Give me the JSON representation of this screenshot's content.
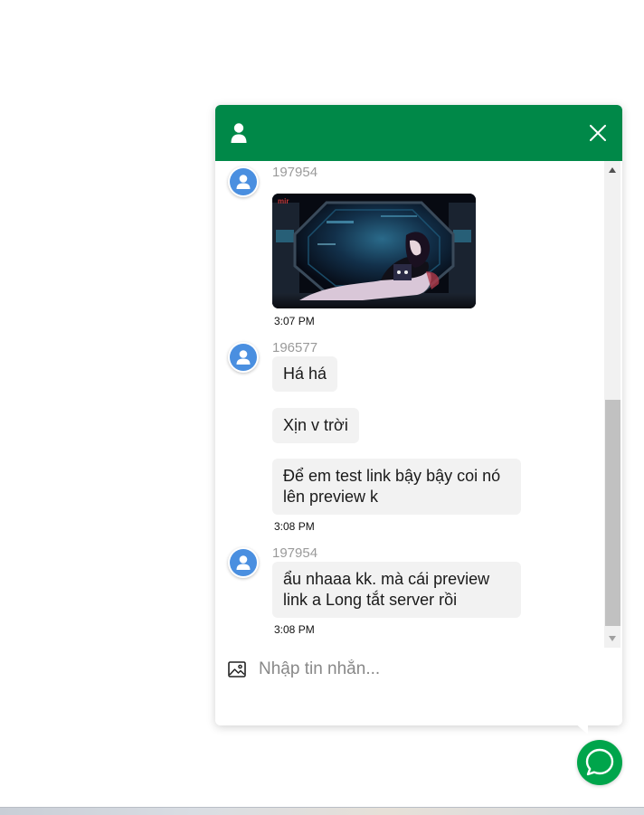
{
  "chat": {
    "header": {
      "user_icon": "user-icon",
      "close_icon": "close-icon"
    },
    "messages": [
      {
        "sender": "197954",
        "image_alt": "Anime girl lying in front of a sci-fi window",
        "time": "3:07 PM"
      },
      {
        "sender": "196577",
        "bubbles": [
          "Há há",
          "Xịn v trời",
          "Để em test link bậy bậy coi nó lên preview k"
        ],
        "time": "3:08 PM"
      },
      {
        "sender": "197954",
        "bubbles": [
          "ẩu nhaaa kk. mà cái preview link a Long tắt server rồi"
        ],
        "time": "3:08 PM"
      }
    ],
    "composer": {
      "placeholder": "Nhập tin nhắn...",
      "value": "",
      "image_icon": "image-icon"
    }
  },
  "launcher": {
    "icon": "chat-bubble-icon"
  },
  "colors": {
    "header": "#008848",
    "launcher": "#00a54b",
    "bubble": "#f2f2f2",
    "avatar": "#4a8fe0"
  }
}
